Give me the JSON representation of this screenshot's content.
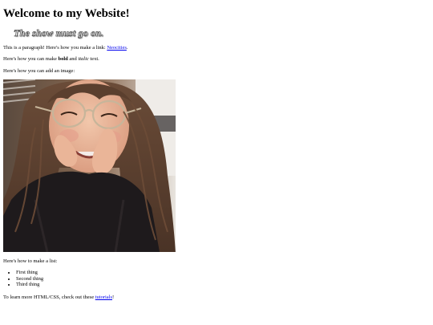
{
  "heading": "Welcome to my Website!",
  "script_text": "The show must go on.",
  "link_paragraph": {
    "before": "This is a paragraph! Here's how you make a link: ",
    "link": "Neocities",
    "after": "."
  },
  "format_paragraph": {
    "before": "Here's how you can make ",
    "bold": "bold",
    "middle": " and ",
    "italic": "italic",
    "after": " text."
  },
  "image_paragraph": "Here's how you can add an image:",
  "list_intro": "Here's how to make a list:",
  "list_items": [
    "First thing",
    "Second thing",
    "Third thing"
  ],
  "learn_paragraph": {
    "before": "To learn more HTML/CSS, check out these ",
    "link": "tutorials",
    "after": "!"
  },
  "colors": {
    "link": "#0000ee",
    "text": "#000000",
    "background": "#ffffff"
  }
}
